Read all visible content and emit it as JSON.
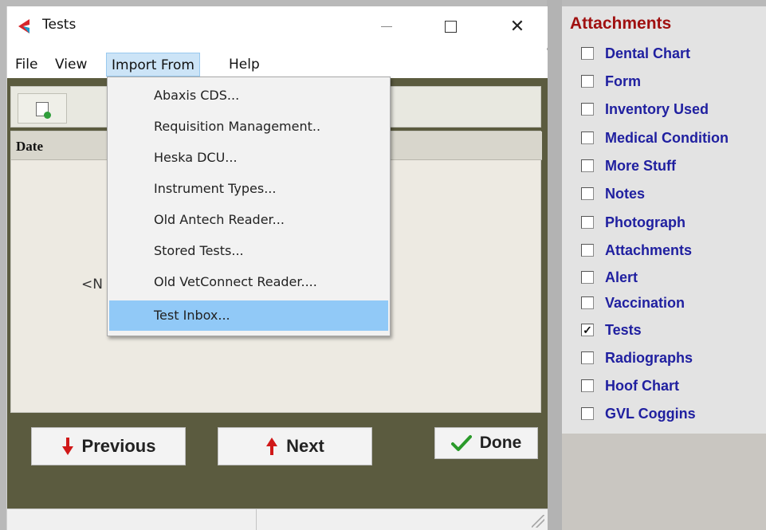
{
  "window": {
    "title": "Tests",
    "controls": {
      "minimize": "—",
      "maximize": "□",
      "close": "✕"
    }
  },
  "menubar": {
    "items": [
      {
        "label": "File"
      },
      {
        "label": "View"
      },
      {
        "label": "Import From",
        "active": true
      },
      {
        "label": "Help"
      }
    ]
  },
  "toolbar": {
    "new_icon": "new-document-icon"
  },
  "list": {
    "column_header": "Date",
    "empty_text": "<N"
  },
  "import_menu": {
    "items": [
      "Abaxis CDS...",
      "Requisition Management..",
      "Heska DCU...",
      "Instrument Types...",
      "Old Antech Reader...",
      "Stored Tests...",
      "Old VetConnect Reader....",
      "Test Inbox..."
    ],
    "highlighted_index": 7
  },
  "buttons": {
    "previous": "Previous",
    "next": "Next",
    "done": "Done"
  },
  "attachments": {
    "title": "Attachments",
    "items": [
      {
        "label": "Dental Chart",
        "checked": false
      },
      {
        "label": "Form",
        "checked": false
      },
      {
        "label": "Inventory Used",
        "checked": false
      },
      {
        "label": "Medical Condition",
        "checked": false
      },
      {
        "label": "More Stuff",
        "checked": false
      },
      {
        "label": "Notes",
        "checked": false
      },
      {
        "label": "Photograph",
        "checked": false
      },
      {
        "label": "Attachments",
        "checked": false
      },
      {
        "label": "Alert",
        "checked": false
      },
      {
        "label": "Vaccination",
        "checked": false
      },
      {
        "label": "Tests",
        "checked": true
      },
      {
        "label": "Radiographs",
        "checked": false
      },
      {
        "label": "Hoof Chart",
        "checked": false
      },
      {
        "label": "GVL Coggins",
        "checked": false
      }
    ]
  },
  "colors": {
    "accent_title": "#a01010",
    "attachment_label": "#2020a0",
    "menu_highlight": "#91c9f7",
    "frame_dark": "#5b5b3f",
    "previous_arrow": "#d01818",
    "next_arrow": "#d01818",
    "done_check": "#2a9a2a"
  }
}
